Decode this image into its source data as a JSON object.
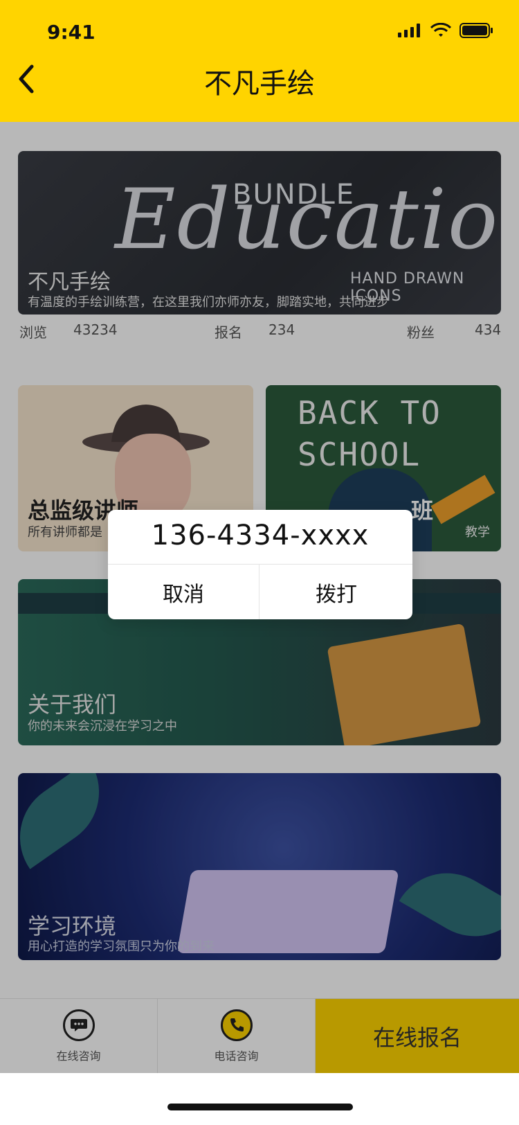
{
  "status_bar": {
    "time": "9:41"
  },
  "header": {
    "title": "不凡手绘",
    "background_color": "#FFD400"
  },
  "banner": {
    "title": "不凡手绘",
    "subtitle": "有温度的手绘训练营，在这里我们亦师亦友，脚踏实地，共同进步",
    "art_text_top": "BUNDLE",
    "art_text_main": "Education",
    "art_text_bottom": "HAND DRAWN ICONS",
    "stats": [
      {
        "label": "浏览",
        "value": "43234"
      },
      {
        "label": "报名",
        "value": "234"
      },
      {
        "label": "粉丝",
        "value": "434"
      }
    ]
  },
  "cards": {
    "teacher": {
      "title": "总监级讲师",
      "subtitle": "所有讲师都是"
    },
    "school": {
      "art_text_1": "BACK TO",
      "art_text_2": "SCHOOL",
      "title": "班",
      "subtitle": "教学"
    },
    "about": {
      "title": "关于我们",
      "subtitle": "你的未来会沉浸在学习之中"
    },
    "environment": {
      "title": "学习环境",
      "subtitle": "用心打造的学习氛围只为你的到来"
    }
  },
  "bottom_bar": {
    "chat_label": "在线咨询",
    "phone_label": "电话咨询",
    "signup_label": "在线报名",
    "icons": [
      "chat-bubble-icon",
      "phone-icon"
    ]
  },
  "dialog": {
    "phone_number": "136-4334-xxxx",
    "cancel_label": "取消",
    "call_label": "拨打"
  }
}
